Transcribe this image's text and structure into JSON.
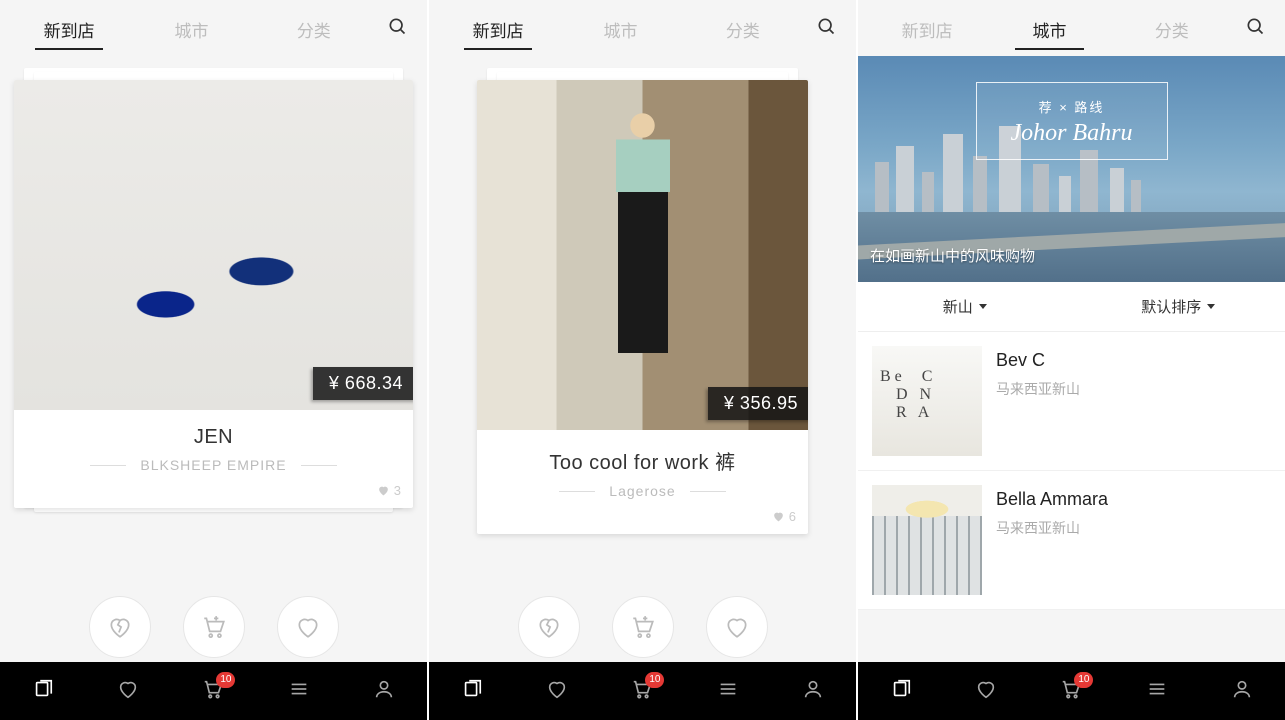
{
  "tabs": {
    "new": "新到店",
    "city": "城市",
    "category": "分类"
  },
  "screens": [
    {
      "activeTab": "new",
      "card": {
        "title": "JEN",
        "brand": "BLKSHEEP EMPIRE",
        "price": "¥ 668.34",
        "likes": "3"
      },
      "cartBadge": "10"
    },
    {
      "activeTab": "new",
      "card": {
        "title": "Too cool for work 裤",
        "brand": "Lagerose",
        "price": "¥ 356.95",
        "likes": "6"
      },
      "cartBadge": "10"
    },
    {
      "activeTab": "city",
      "hero": {
        "prefix": "荐 × 路线",
        "title": "Johor Bahru",
        "caption": "在如画新山中的风味购物"
      },
      "filters": {
        "location": "新山",
        "sort": "默认排序"
      },
      "stores": [
        {
          "name": "Bev C",
          "location": "马来西亚新山"
        },
        {
          "name": "Bella Ammara",
          "location": "马来西亚新山"
        }
      ],
      "cartBadge": "10"
    }
  ]
}
